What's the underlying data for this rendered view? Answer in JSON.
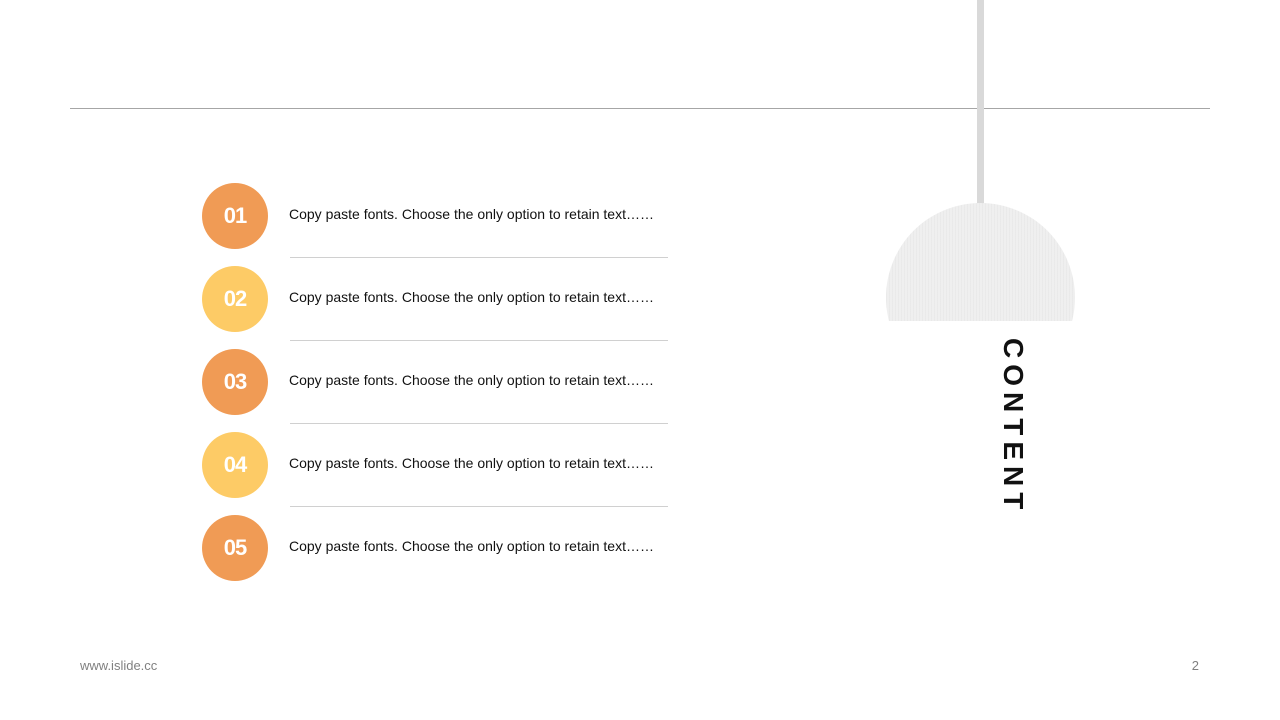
{
  "header": {
    "title": "CONTENT"
  },
  "items": [
    {
      "number": "01",
      "text": "Copy paste fonts. Choose the only option to retain text……",
      "color": "#f09b55"
    },
    {
      "number": "02",
      "text": "Copy paste fonts. Choose the only option to retain text……",
      "color": "#fdcb66"
    },
    {
      "number": "03",
      "text": "Copy paste fonts. Choose the only option to retain text……",
      "color": "#f09b55"
    },
    {
      "number": "04",
      "text": "Copy paste fonts. Choose the only option to retain text……",
      "color": "#fdcb66"
    },
    {
      "number": "05",
      "text": "Copy paste fonts. Choose the only option to retain text……",
      "color": "#f09b55"
    }
  ],
  "footer": {
    "url": "www.islide.cc",
    "page_number": "2"
  },
  "colors": {
    "accent_orange": "#f09b55",
    "accent_yellow": "#fdcb66",
    "rule_gray": "#a6a6a6",
    "lamp_gray": "#d9d9d9"
  }
}
